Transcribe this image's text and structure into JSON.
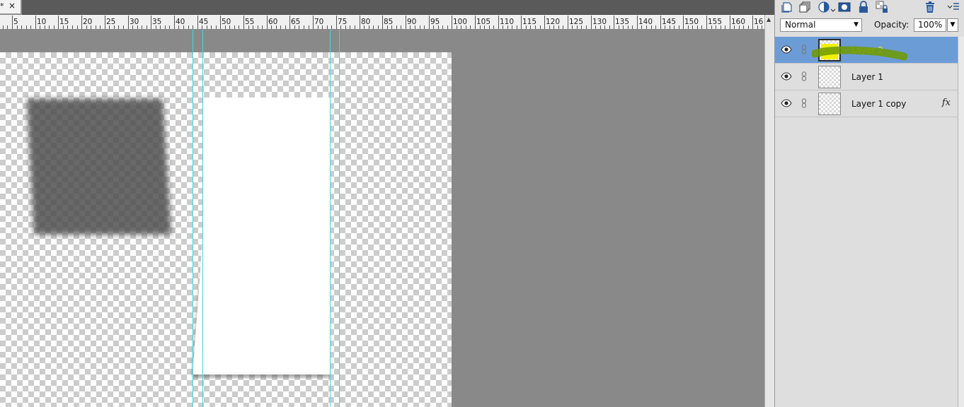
{
  "document_tab": {
    "title": "*",
    "close": "×"
  },
  "ruler": {
    "labels": [
      "5",
      "10",
      "15",
      "20",
      "25",
      "30",
      "35",
      "40",
      "45",
      "50",
      "55",
      "60",
      "65",
      "70",
      "75",
      "80",
      "85",
      "90",
      "95",
      "100",
      "105",
      "110",
      "115",
      "120",
      "125",
      "130",
      "135",
      "140",
      "145",
      "150",
      "155",
      "160",
      "16"
    ]
  },
  "layers_panel": {
    "toolbar_icons": [
      "new-layer-icon",
      "new-group-icon",
      "adjustment-layer-icon",
      "layer-mask-icon",
      "lock-icon",
      "lock-transparency-icon",
      "trash-icon",
      "panel-menu-icon"
    ],
    "blend_mode": "Normal",
    "opacity_label": "Opacity:",
    "opacity_value": "100%",
    "layers": [
      {
        "name": "Layer 2",
        "selected": true,
        "has_fx": false,
        "thumb": "yellow"
      },
      {
        "name": "Layer 1",
        "selected": false,
        "has_fx": false,
        "thumb": "transparent"
      },
      {
        "name": "Layer 1 copy",
        "selected": false,
        "has_fx": true,
        "fx_label": "fx",
        "thumb": "transparent"
      }
    ]
  },
  "colors": {
    "selected_row": "#6c9cd6",
    "guide": "#46d6e2",
    "highlight_marker": "#6f9a00",
    "layer_thumb_fill": "#f2f200"
  }
}
